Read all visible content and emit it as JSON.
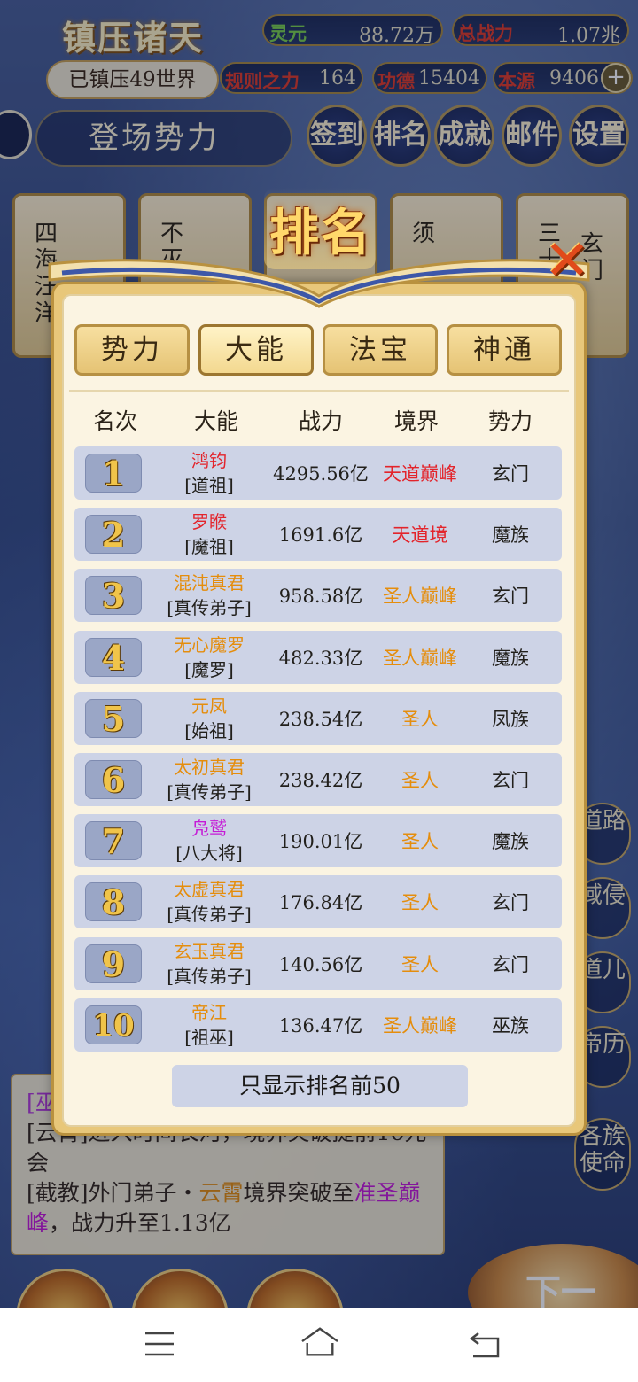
{
  "header": {
    "game_title": "镇压诸天",
    "world_count": "已镇压49世界",
    "stats": {
      "lingyuan_label": "灵元",
      "lingyuan_value": "88.72万",
      "total_power_label": "总战力",
      "total_power_value": "1.07兆",
      "rule_power_label": "规则之力",
      "rule_power_value": "164",
      "merit_label": "功德",
      "merit_value": "15404",
      "origin_label": "本源",
      "origin_value": "9406"
    },
    "appear_force_label": "登场势力",
    "buttons": [
      "签到",
      "排名",
      "成就",
      "邮件",
      "设置"
    ]
  },
  "bg_cards": [
    "四海汪洋",
    "不灭",
    "须",
    "三十",
    "玄门"
  ],
  "log": {
    "line1_prefix": "[巫",
    "line2": "[云霄]进入时间长河，境界突破提前16元会",
    "line3_a": "[截教]外门弟子・",
    "line3_name": "云霄",
    "line3_b": "境界突破至",
    "line3_realm": "准圣巅峰",
    "line3_c": "，战力升至1.13亿"
  },
  "right_buttons": [
    "道路",
    "域侵",
    "道儿",
    "帝历",
    "各族使命"
  ],
  "next_button": "下一",
  "modal": {
    "title": "排名",
    "tabs": [
      "势力",
      "大能",
      "法宝",
      "神通"
    ],
    "active_tab": "大能",
    "columns": [
      "名次",
      "大能",
      "战力",
      "境界",
      "势力"
    ],
    "rows": [
      {
        "rank": "1",
        "name": "鸿钧",
        "title": "[道祖]",
        "power": "4295.56亿",
        "realm": "天道巅峰",
        "force": "玄门",
        "name_color": "#e3242b",
        "realm_color": "#e3242b"
      },
      {
        "rank": "2",
        "name": "罗睺",
        "title": "[魔祖]",
        "power": "1691.6亿",
        "realm": "天道境",
        "force": "魔族",
        "name_color": "#e3242b",
        "realm_color": "#e3242b"
      },
      {
        "rank": "3",
        "name": "混沌真君",
        "title": "[真传弟子]",
        "power": "958.58亿",
        "realm": "圣人巅峰",
        "force": "玄门",
        "name_color": "#e58d0c",
        "realm_color": "#e58d0c"
      },
      {
        "rank": "4",
        "name": "无心魔罗",
        "title": "[魔罗]",
        "power": "482.33亿",
        "realm": "圣人巅峰",
        "force": "魔族",
        "name_color": "#e58d0c",
        "realm_color": "#e58d0c"
      },
      {
        "rank": "5",
        "name": "元凤",
        "title": "[始祖]",
        "power": "238.54亿",
        "realm": "圣人",
        "force": "凤族",
        "name_color": "#e58d0c",
        "realm_color": "#e58d0c"
      },
      {
        "rank": "6",
        "name": "太初真君",
        "title": "[真传弟子]",
        "power": "238.42亿",
        "realm": "圣人",
        "force": "玄门",
        "name_color": "#e58d0c",
        "realm_color": "#e58d0c"
      },
      {
        "rank": "7",
        "name": "凫鹫",
        "title": "[八大将]",
        "power": "190.01亿",
        "realm": "圣人",
        "force": "魔族",
        "name_color": "#c51ad6",
        "realm_color": "#e58d0c"
      },
      {
        "rank": "8",
        "name": "太虚真君",
        "title": "[真传弟子]",
        "power": "176.84亿",
        "realm": "圣人",
        "force": "玄门",
        "name_color": "#e58d0c",
        "realm_color": "#e58d0c"
      },
      {
        "rank": "9",
        "name": "玄玉真君",
        "title": "[真传弟子]",
        "power": "140.56亿",
        "realm": "圣人",
        "force": "玄门",
        "name_color": "#e58d0c",
        "realm_color": "#e58d0c"
      },
      {
        "rank": "10",
        "name": "帝江",
        "title": "[祖巫]",
        "power": "136.47亿",
        "realm": "圣人巅峰",
        "force": "巫族",
        "name_color": "#e58d0c",
        "realm_color": "#e58d0c"
      }
    ],
    "footer_note": "只显示排名前50"
  },
  "navbar": {
    "icons": [
      "menu-icon",
      "home-icon",
      "back-icon"
    ]
  }
}
